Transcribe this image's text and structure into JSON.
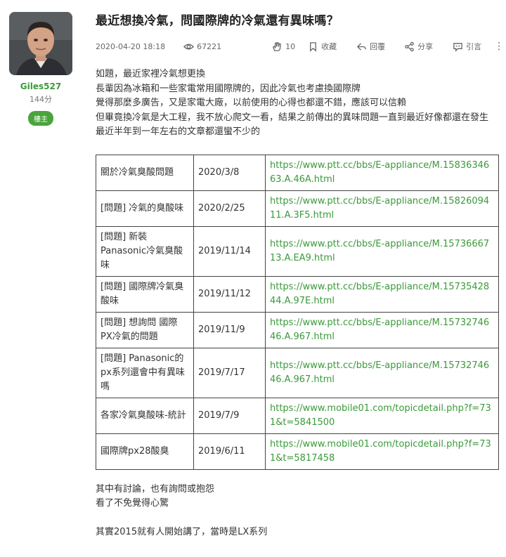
{
  "author": {
    "username": "Giles527",
    "points": "144分",
    "badge": "樓主"
  },
  "post": {
    "title": "最近想換冷氣，問國際牌的冷氣還有異味嗎？",
    "date": "2020-04-20 18:18",
    "views": "67221",
    "likes": "10",
    "collect_label": "收藏",
    "reply_label": "回覆",
    "share_label": "分享",
    "quote_label": "引言",
    "more_label": "⋮",
    "body": [
      "如題，最近家裡冷氣想更換",
      "長輩因為冰箱和一些家電常用國際牌的，因此冷氣也考慮換國際牌",
      "覺得那麼多廣告，又是家電大廠，以前使用的心得也都還不錯，應該可以信賴",
      "但畢竟換冷氣是大工程，我不放心爬文一看，結果之前傳出的異味問題一直到最近好像都還在發生",
      "最近半年到一年左右的文章都還蠻不少的"
    ],
    "table": [
      {
        "topic": "關於冷氣臭酸問題",
        "date": "2020/3/8",
        "url": "https://www.ptt.cc/bbs/E-appliance/M.1583634663.A.46A.html"
      },
      {
        "topic": "[問題] 冷氣的臭酸味",
        "date": "2020/2/25",
        "url": "https://www.ptt.cc/bbs/E-appliance/M.1582609411.A.3F5.html"
      },
      {
        "topic": "[問題] 新裝Panasonic冷氣臭酸味",
        "date": "2019/11/14",
        "url": "https://www.ptt.cc/bbs/E-appliance/M.1573666713.A.EA9.html"
      },
      {
        "topic": "[問題] 國際牌冷氣臭酸味",
        "date": "2019/11/12",
        "url": "https://www.ptt.cc/bbs/E-appliance/M.1573542844.A.97E.html"
      },
      {
        "topic": "[問題] 想詢問 國際PX冷氣的問題",
        "date": "2019/11/9",
        "url": "https://www.ptt.cc/bbs/E-appliance/M.1573274646.A.967.html"
      },
      {
        "topic": "[問題] Panasonic的px系列還會中有異味嗎",
        "date": "2019/7/17",
        "url": "https://www.ptt.cc/bbs/E-appliance/M.1573274646.A.967.html"
      },
      {
        "topic": "各家冷氣臭酸味-統計",
        "date": "2019/7/9",
        "url": "https://www.mobile01.com/topicdetail.php?f=731&t=5841500"
      },
      {
        "topic": "國際牌px28酸臭",
        "date": "2019/6/11",
        "url": "https://www.mobile01.com/topicdetail.php?f=731&t=5817458"
      }
    ],
    "after": [
      "其中有討論，也有詢問或抱怨",
      "看了不免覺得心驚",
      "",
      "其實2015就有人開始講了，當時是LX系列"
    ]
  }
}
